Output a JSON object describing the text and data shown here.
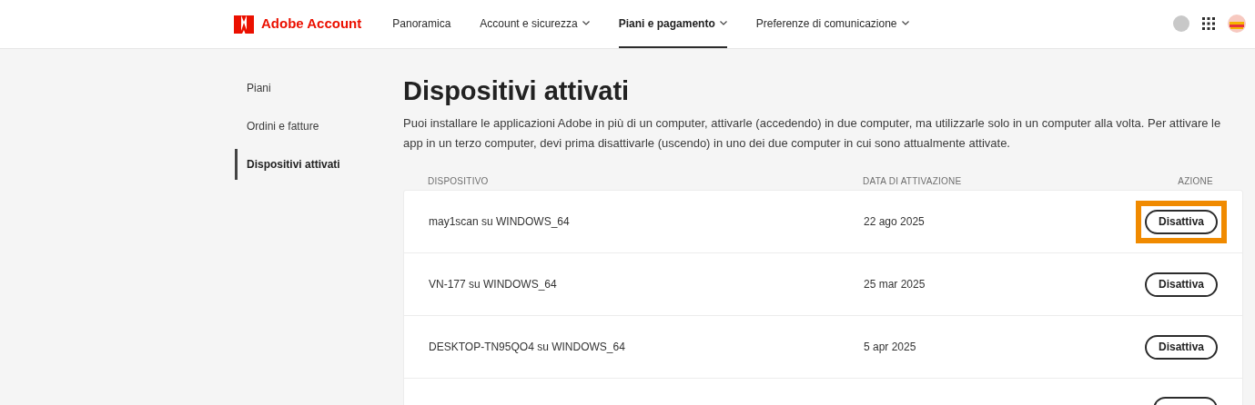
{
  "header": {
    "logo": "Adobe Account",
    "nav": [
      {
        "label": "Panoramica",
        "dropdown": false,
        "selected": false
      },
      {
        "label": "Account e sicurezza",
        "dropdown": true,
        "selected": false
      },
      {
        "label": "Piani e pagamento",
        "dropdown": true,
        "selected": true
      },
      {
        "label": "Preferenze di comunicazione",
        "dropdown": true,
        "selected": false
      }
    ]
  },
  "sidebar": {
    "items": [
      {
        "label": "Piani",
        "selected": false
      },
      {
        "label": "Ordini e fatture",
        "selected": false
      },
      {
        "label": "Dispositivi attivati",
        "selected": true
      }
    ]
  },
  "page": {
    "title": "Dispositivi attivati",
    "description": "Puoi installare le applicazioni Adobe in più di un computer, attivarle (accedendo) in due computer, ma utilizzarle solo in un computer alla volta. Per attivare le app in un terzo computer, devi prima disattivarle (uscendo) in uno dei due computer in cui sono attualmente attivate."
  },
  "table": {
    "columns": [
      "DISPOSITIVO",
      "DATA DI ATTIVAZIONE",
      "AZIONE"
    ],
    "rows": [
      {
        "device": "may1scan su WINDOWS_64",
        "date": "22 ago 2025",
        "action": "Disattiva",
        "highlighted": true
      },
      {
        "device": "VN-177 su WINDOWS_64",
        "date": "25 mar 2025",
        "action": "Disattiva",
        "highlighted": false
      },
      {
        "device": "DESKTOP-TN95QO4 su WINDOWS_64",
        "date": "5 apr 2025",
        "action": "Disattiva",
        "highlighted": false
      }
    ]
  }
}
